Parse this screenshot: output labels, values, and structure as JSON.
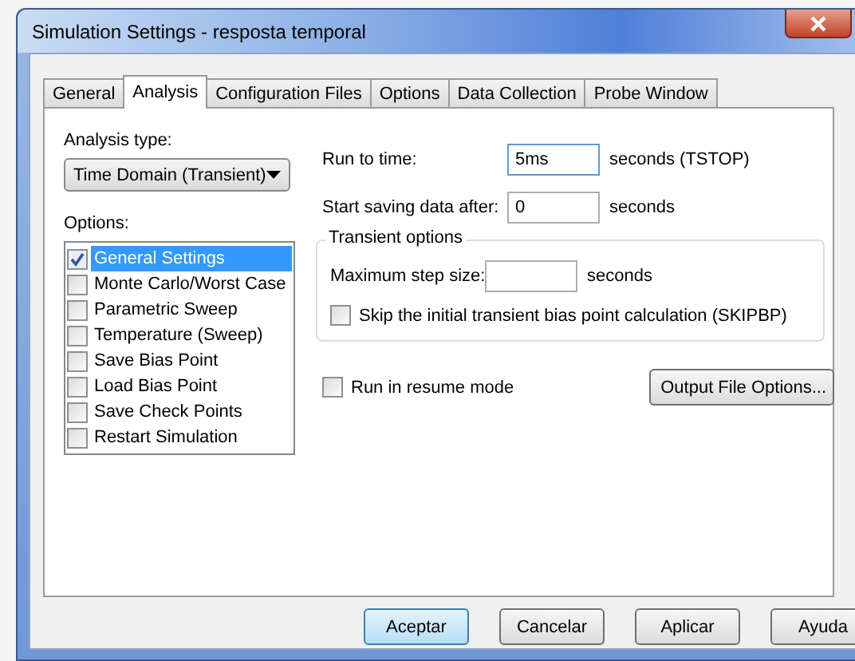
{
  "window": {
    "title": "Simulation Settings - resposta temporal"
  },
  "tabs": [
    {
      "label": "General",
      "selected": false
    },
    {
      "label": "Analysis",
      "selected": true
    },
    {
      "label": "Configuration Files",
      "selected": false
    },
    {
      "label": "Options",
      "selected": false
    },
    {
      "label": "Data Collection",
      "selected": false
    },
    {
      "label": "Probe Window",
      "selected": false
    }
  ],
  "analysis_type": {
    "label": "Analysis type:",
    "value": "Time Domain (Transient)"
  },
  "options": {
    "label": "Options:",
    "items": [
      {
        "label": "General Settings",
        "checked": true,
        "selected": true
      },
      {
        "label": "Monte Carlo/Worst Case",
        "checked": false,
        "selected": false
      },
      {
        "label": "Parametric Sweep",
        "checked": false,
        "selected": false
      },
      {
        "label": "Temperature (Sweep)",
        "checked": false,
        "selected": false
      },
      {
        "label": "Save Bias Point",
        "checked": false,
        "selected": false
      },
      {
        "label": "Load Bias Point",
        "checked": false,
        "selected": false
      },
      {
        "label": "Save Check Points",
        "checked": false,
        "selected": false
      },
      {
        "label": "Restart Simulation",
        "checked": false,
        "selected": false
      }
    ]
  },
  "run_to_time": {
    "label": "Run to time:",
    "value": "5ms",
    "unit": "seconds  (TSTOP)"
  },
  "start_saving": {
    "label": "Start saving data after:",
    "value": "0",
    "unit": "seconds"
  },
  "transient_options": {
    "title": "Transient options",
    "max_step": {
      "label": "Maximum step size:",
      "unit": "seconds"
    },
    "skip_bias": {
      "label": "Skip the initial transient bias point calculation  (SKIPBP)",
      "checked": false
    }
  },
  "resume": {
    "label": "Run in resume mode",
    "checked": false
  },
  "output_button": "Output File Options...",
  "buttons": [
    {
      "label": "Aceptar",
      "default": true
    },
    {
      "label": "Cancelar",
      "default": false
    },
    {
      "label": "Aplicar",
      "default": false
    },
    {
      "label": "Ayuda",
      "default": false
    }
  ]
}
